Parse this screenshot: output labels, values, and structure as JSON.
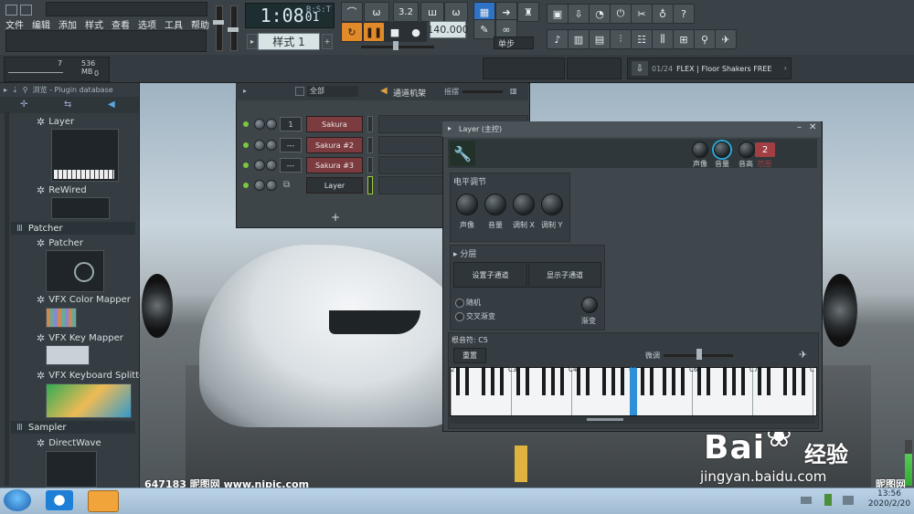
{
  "menu": [
    "文件",
    "编辑",
    "添加",
    "样式",
    "查看",
    "选项",
    "工具",
    "帮助"
  ],
  "transport": {
    "time": "1:08",
    "time_small": "01",
    "time_corner": "B:S:T",
    "pattern": "样式 1",
    "tempo": "140.000",
    "time_sig": "3.2",
    "step_mode": "单步"
  },
  "cpu": {
    "mem_count": "7",
    "mem": "536 MB",
    "poly": "0"
  },
  "hint_bar": {
    "index": "01/24",
    "text": "FLEX | Floor Shakers FREE"
  },
  "browser": {
    "header": "浏览 - Plugin database",
    "items": [
      {
        "label": "Layer"
      },
      {
        "label": "ReWired"
      },
      {
        "label": "Patcher"
      },
      {
        "label": "VFX Color Mapper"
      },
      {
        "label": "VFX Key Mapper"
      },
      {
        "label": "VFX Keyboard Splitter"
      },
      {
        "label": "DirectWave"
      }
    ],
    "folders": [
      "Patcher",
      "Sampler"
    ]
  },
  "channel_rack": {
    "filter": "全部",
    "title": "通道机架",
    "swing": "摇摆",
    "channels": [
      {
        "num": "1",
        "name": "Sakura"
      },
      {
        "num": "---",
        "name": "Sakura #2"
      },
      {
        "num": "---",
        "name": "Sakura #3"
      },
      {
        "num": "",
        "name": "Layer"
      }
    ],
    "add": "+"
  },
  "layer_window": {
    "title": "Layer (主控)",
    "knobs": [
      "声像",
      "音量",
      "音高",
      "范围"
    ],
    "pitch_range": "2",
    "level_section": "电平调节",
    "level_knobs": [
      "声像",
      "音量",
      "调制 X",
      "调制 Y"
    ],
    "split_section": "分层",
    "set_children": "设置子通道",
    "show_children": "显示子通道",
    "random": "随机",
    "crossfade": "交叉渐变",
    "fade": "渐变",
    "root_note": "根音符: C5",
    "reset": "重置",
    "fine_tune": "微调",
    "octaves": [
      "2",
      "C3",
      "C4",
      "C5",
      "C6",
      "C7",
      "C"
    ]
  },
  "watermark": {
    "left": "647183 昵图网 www.nipic.com",
    "baidu": "Bai",
    "baidu2": "经验",
    "url": "jingyan.baidu.com",
    "right": "昵图网"
  },
  "taskbar": {
    "time": "13:56",
    "date": "2020/2/20"
  }
}
